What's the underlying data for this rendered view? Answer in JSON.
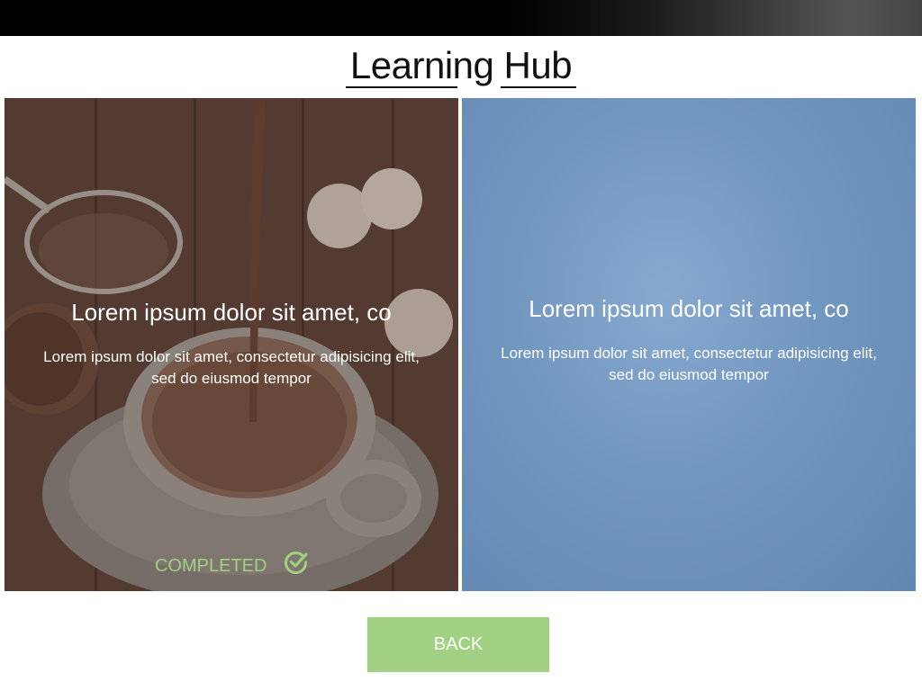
{
  "header": {
    "title": "Learning Hub"
  },
  "cards": [
    {
      "heading": "Lorem ipsum dolor sit amet, co",
      "body": "Lorem ipsum dolor sit amet, consectetur adipisicing elit, sed do eiusmod tempor",
      "status": "COMPLETED",
      "status_icon": "check-circle-icon"
    },
    {
      "heading": "Lorem ipsum dolor sit amet, co",
      "body": "Lorem ipsum dolor sit amet, consectetur adipisicing elit, sed do eiusmod tempor"
    }
  ],
  "footer": {
    "back_label": "BACK"
  },
  "colors": {
    "accent_green": "#a3d183",
    "status_green": "#9fd07e",
    "card_blue": "#7196c0"
  }
}
